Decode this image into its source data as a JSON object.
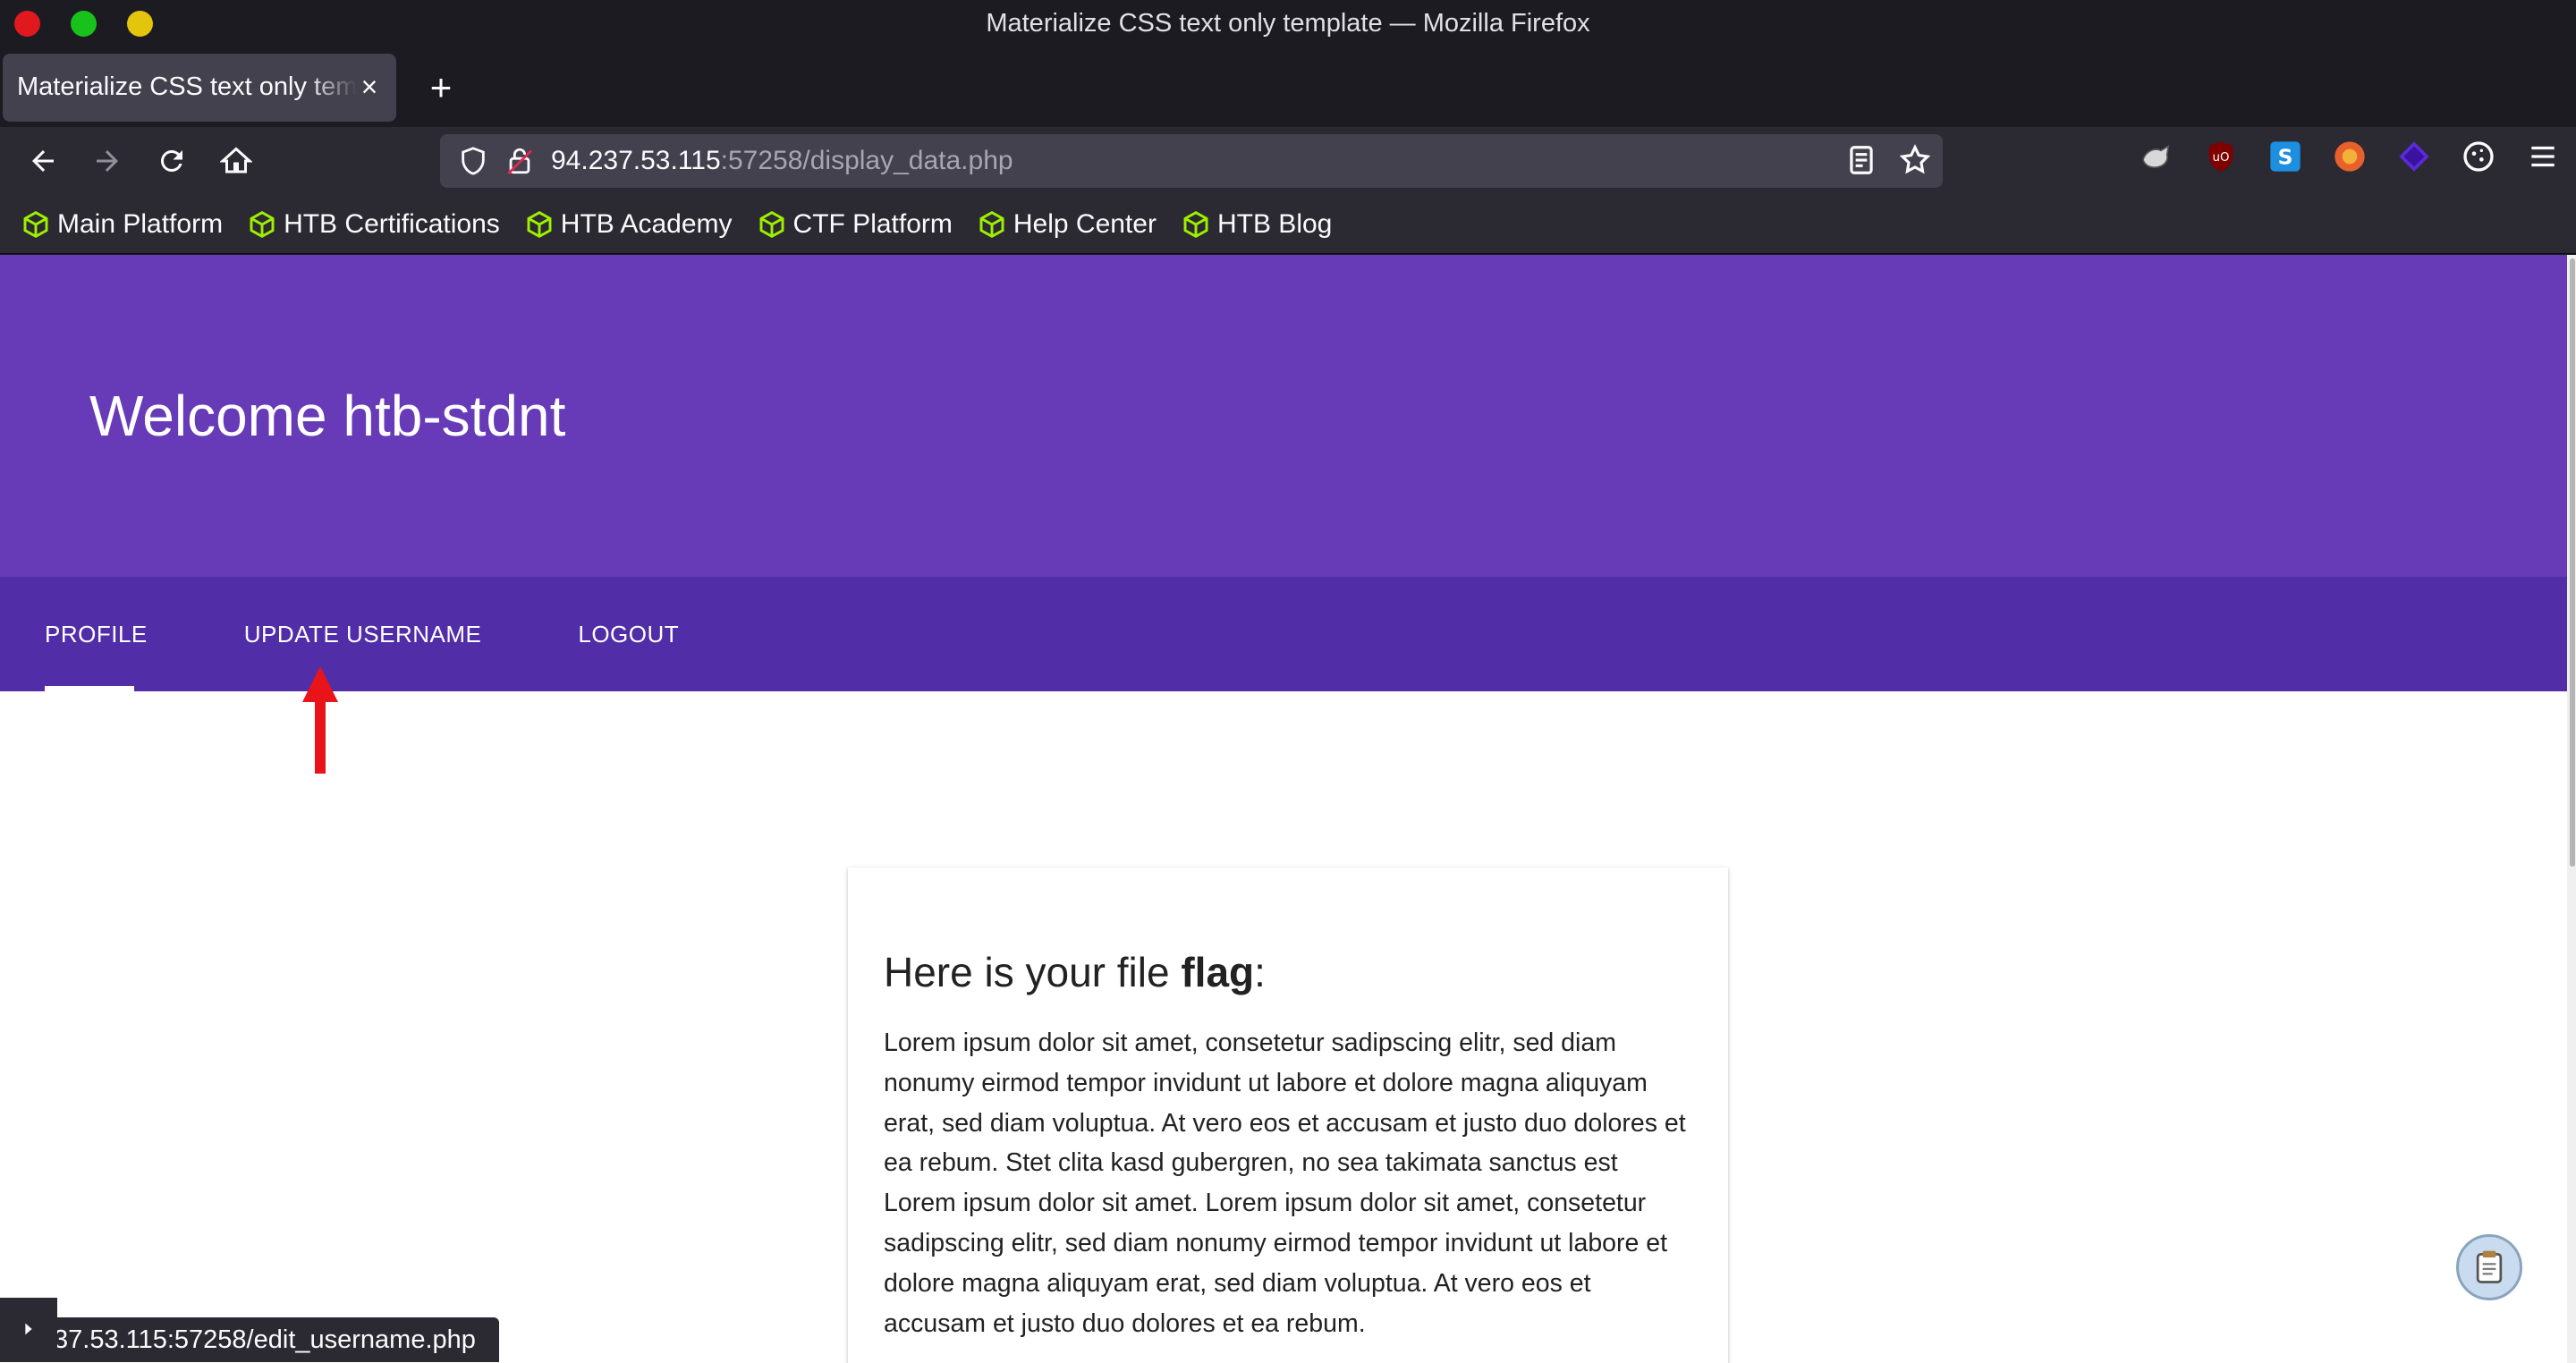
{
  "window": {
    "title": "Materialize CSS text only template — Mozilla Firefox"
  },
  "tabs": [
    {
      "label": "Materialize CSS text only template"
    }
  ],
  "url": {
    "host": "94.237.53.115",
    "rest": ":57258/display_data.php"
  },
  "bookmarks": [
    {
      "label": "Main Platform"
    },
    {
      "label": "HTB Certifications"
    },
    {
      "label": "HTB Academy"
    },
    {
      "label": "CTF Platform"
    },
    {
      "label": "Help Center"
    },
    {
      "label": "HTB Blog"
    }
  ],
  "page": {
    "heading": "Welcome htb-stdnt",
    "nav": {
      "profile": "PROFILE",
      "update_username": "UPDATE USERNAME",
      "logout": "LOGOUT"
    },
    "card": {
      "title_prefix": "Here is your file ",
      "title_bold": "flag",
      "title_suffix": ":",
      "body": "Lorem ipsum dolor sit amet, consetetur sadipscing elitr, sed diam nonumy eirmod tempor invidunt ut labore et dolore magna aliquyam erat, sed diam voluptua. At vero eos et accusam et justo duo dolores et ea rebum. Stet clita kasd gubergren, no sea takimata sanctus est Lorem ipsum dolor sit amet. Lorem ipsum dolor sit amet, consetetur sadipscing elitr, sed diam nonumy eirmod tempor invidunt ut labore et dolore magna aliquyam erat, sed diam voluptua. At vero eos et accusam et justo duo dolores et ea rebum."
    }
  },
  "status": {
    "link": "37.53.115:57258/edit_username.php"
  },
  "colors": {
    "hero": "#673ab7",
    "nav": "#512da8",
    "annotation_arrow": "#e8141a"
  }
}
